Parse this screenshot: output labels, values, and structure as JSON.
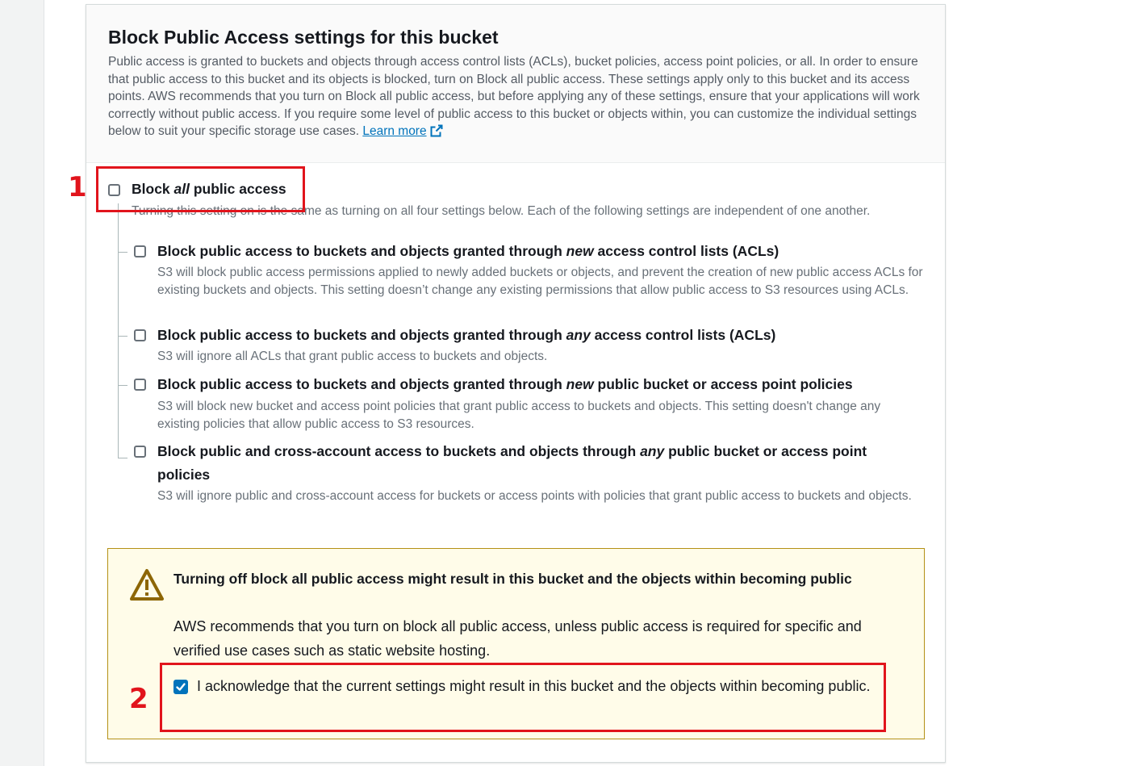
{
  "section": {
    "title": "Block Public Access settings for this bucket",
    "intro": "Public access is granted to buckets and objects through access control lists (ACLs), bucket policies, access point policies, or all. In order to ensure that public access to this bucket and its objects is blocked, turn on Block all public access. These settings apply only to this bucket and its access points. AWS recommends that you turn on Block all public access, but before applying any of these settings, ensure that your applications will work correctly without public access. If you require some level of public access to this bucket or objects within, you can customize the individual settings below to suit your specific storage use cases.",
    "learn_more": "Learn more",
    "learn_more_icon": "external-link-icon"
  },
  "block_all": {
    "label_pre": "Block ",
    "label_em": "all",
    "label_post": " public access",
    "description": "Turning this setting on is the same as turning on all four settings below. Each of the following settings are independent of one another.",
    "checked": false
  },
  "options": [
    {
      "title_pre": "Block public access to buckets and objects granted through ",
      "title_em": "new",
      "title_post": " access control lists (ACLs)",
      "description": "S3 will block public access permissions applied to newly added buckets or objects, and prevent the creation of new public access ACLs for existing buckets and objects. This setting doesn’t change any existing permissions that allow public access to S3 resources using ACLs.",
      "checked": false
    },
    {
      "title_pre": "Block public access to buckets and objects granted through ",
      "title_em": "any",
      "title_post": " access control lists (ACLs)",
      "description": "S3 will ignore all ACLs that grant public access to buckets and objects.",
      "checked": false
    },
    {
      "title_pre": "Block public access to buckets and objects granted through ",
      "title_em": "new",
      "title_post": " public bucket or access point policies",
      "description": "S3 will block new bucket and access point policies that grant public access to buckets and objects. This setting doesn't change any existing policies that allow public access to S3 resources.",
      "checked": false
    },
    {
      "title_pre": "Block public and cross-account access to buckets and objects through ",
      "title_em": "any",
      "title_post": " public bucket or access point policies",
      "description": "S3 will ignore public and cross-account access for buckets or access points with policies that grant public access to buckets and objects.",
      "checked": false
    }
  ],
  "warning": {
    "icon": "warning-triangle-icon",
    "title": "Turning off block all public access might result in this bucket and the objects within becoming public",
    "body": "AWS recommends that you turn on block all public access, unless public access is required for specific and verified use cases such as static website hosting.",
    "acknowledge_label": "I acknowledge that the current settings might result in this bucket and the objects within becoming public.",
    "acknowledge_checked": true
  },
  "annotations": {
    "first": "1",
    "second": "2",
    "color": "#e1141c"
  },
  "colors": {
    "link": "#0073bb",
    "checkbox_checked": "#0073bb",
    "warning_bg": "#fffce9",
    "warning_border": "#b49116",
    "warning_icon": "#8d6605"
  }
}
